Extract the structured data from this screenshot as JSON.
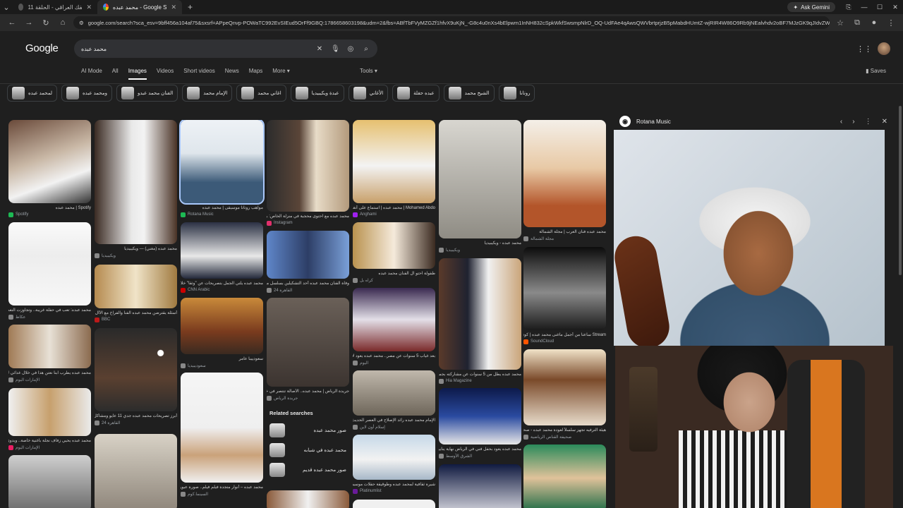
{
  "browser": {
    "tabs": [
      {
        "label": "شارك الفك العراقي - الحلقة 11",
        "active": false
      },
      {
        "label": "محمد عبده - Google Search",
        "active": true
      }
    ],
    "gemini_label": "Ask Gemini",
    "url": "google.com/search?sca_esv=9bff456a104af75&sxsrf=APpeQnvp-POWaTC992EvSIEud5OrFf9GBQ:1786658603198&udm=2&fbs=ABfTbFVyMZGZf1hfvX9uKjN_-G8c4u0nXs4bElpwm1InNH832cSpkWkfSwsmpNlrD_OQ-UdFAe4qAwsQWVbrtprjzB5pMabdHUmtZ-wjRIR4W86O9Rb9jNEalvhdv2oBF7MJzGK9qJIdvZWoiJmYaFeBlzlM5SzNha7yJAFdirOJqZv..."
  },
  "google": {
    "logo": "Google",
    "query": "محمد عبده",
    "nav_tabs": [
      "AI Mode",
      "All",
      "Images",
      "Videos",
      "Short videos",
      "News",
      "Maps",
      "More"
    ],
    "selected_tab": "Images",
    "tools": "Tools",
    "saves": "Saves",
    "chips": [
      "لمحمد عبده",
      "ومحمد عبده",
      "الفنان محمد عبدو",
      "الإمام محمد",
      "اغاني محمد",
      "عبدة ويكيبيديا",
      "الأغاني",
      "عبده حفلة",
      "الشيخ محمد",
      "روتانا"
    ]
  },
  "results": {
    "col0": [
      {
        "caption": "Spotify | محمد عبده",
        "source": "Spotify",
        "color": "#1db954"
      },
      {
        "caption": "محمد عبده: تعب في حفلة غريبة.. وتجاوزت التعب بسعة",
        "source": "عكاظ",
        "color": "#888888"
      },
      {
        "caption": "محمد عبده يطرب ابنا نعتن هذا في خلال غدائي لسنة",
        "source": "الإمارات اليوم",
        "color": "#888888"
      },
      {
        "caption": "محمد عبده يحيي زفاف نجلة بأغنية خاصة.. ويدوي ارتاله",
        "source": "الإمارات اليوم",
        "color": "#e91e63"
      }
    ],
    "col1": [
      {
        "caption": "محمد عبده (مغني) — ويكيبيديا",
        "source": "ويكيبيديا",
        "color": "#888888"
      },
      {
        "caption": "أسئلة يقترضن محمد عبده الفنا والفراخ مع الأال مرة زيان فيه",
        "source": "BBC",
        "color": "#bb1919"
      },
      {
        "caption": "أبرز تصريحات محمد عبده جدي 11 عايو ومشاكل عمر",
        "source": "القاهرة 24",
        "color": "#888888"
      }
    ],
    "col2": [
      {
        "caption": "مواهب روتانا موسيقى | محمد عبده",
        "source": "Rotana Music",
        "color": "#1db954"
      },
      {
        "caption": "محمد عبده يلتي الجمل بتصريحات عن \"وثقا\" خلال صباح",
        "source": "CNN Arabic",
        "color": "#cc0000"
      },
      {
        "caption": "سعودييبا عامر",
        "source": "سعوديبيديا",
        "color": "#888888"
      },
      {
        "caption": "محمد عبده – أنوار متجدة فيلم فيلم.. صورة عبور",
        "source": "السينما.كوم",
        "color": "#888888"
      }
    ],
    "col3": [
      {
        "caption": "محمد عبده مع احتوى محجبة في منزلة الخاص: بلا فيه",
        "source": "Instagram",
        "color": "#e1306c"
      },
      {
        "caption": "وفاة الفنان محمد عبده أحد التشكيلين بسلسل مع سلن",
        "source": "القاهرة 24",
        "color": "#888888"
      },
      {
        "caption": "جريدة الرياض | محمد عبده.. الأصالة تنتصر في خلل",
        "source": "جريدة الرياض",
        "color": "#888888"
      }
    ],
    "related": {
      "title": "Related searches",
      "items": [
        "صور محمد عبده",
        "محمد عبده في شبابه",
        "صور محمد عبده قديم"
      ]
    },
    "col4": [
      {
        "caption": "Mohamed Abdo | محمد عبده | استماع على أنغامي",
        "source": "Anghami",
        "color": "#a020f0"
      },
      {
        "caption": "طفولة احتو آل الفنان محمد عبده",
        "source": "كراه بل",
        "color": "#888888"
      },
      {
        "caption": "بعد غياب 5 سنوات عن مصر.. محمد عبده يعود لإحياء حفل",
        "source": "اليوم",
        "color": "#888888"
      },
      {
        "caption": "الإمام محمد عبده رائد الإصلاح في العصر الحديث - إسلام",
        "source": "إسلام أون لاين",
        "color": "#888888"
      },
      {
        "caption": "شيرة ثقافية لمحمد عبده وطوقيقة حفلات موسيقية ونوار",
        "source": "Platinumlist",
        "color": "#6a1b9a"
      }
    ],
    "col5": [
      {
        "caption": "محمد عبده - ويكيبيديا",
        "source": "ويكيبيديا",
        "color": "#888888"
      },
      {
        "caption": "محمد عبده يطل من 5 سنوات عن مشاركته بجمهوره بعد",
        "source": "Hia Magazine",
        "color": "#888888"
      },
      {
        "caption": "محمد عبده يعود بحفل فني في الرياض نهاية يناير",
        "source": "الشرق الأوسط",
        "color": "#888888"
      }
    ],
    "col6": [
      {
        "caption": "محمد عبده فنان العرب | مجلة الشمالة",
        "source": "مجلة الشمالة",
        "color": "#888888"
      },
      {
        "caption": "Stream ساعتا من أجمل ماغنى محمد عبده | كوتيفي",
        "source": "SoundCloud",
        "color": "#ff5500"
      },
      {
        "caption": "هيئة الترفيه تجهز سلسلاً لعودة محمد عبده - صحيفة القنا",
        "source": "صحيفة القناص الرياضية",
        "color": "#888888"
      }
    ]
  },
  "panel": {
    "source": "Rotana Music"
  }
}
